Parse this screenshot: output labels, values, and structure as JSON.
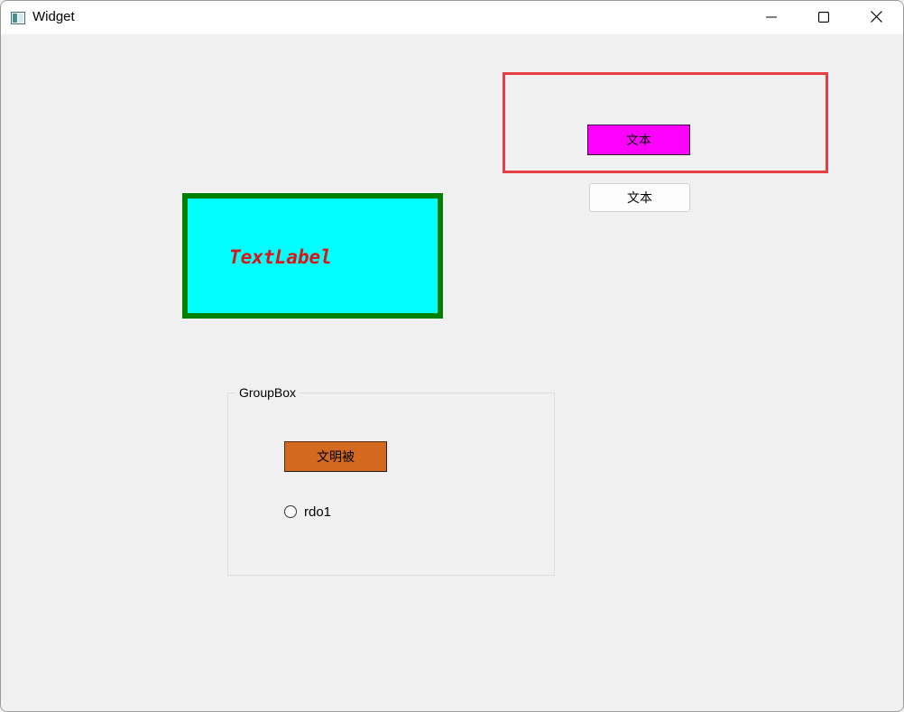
{
  "window": {
    "title": "Widget",
    "icon": "app-window-icon",
    "controls": [
      "minimize-icon",
      "maximize-icon",
      "close-icon"
    ]
  },
  "top_frame": {
    "border_color": "#e84040",
    "button_label": "文本",
    "button_color": "#ff00ff"
  },
  "plain_button": {
    "label": "文本"
  },
  "text_label": {
    "text": "TextLabel",
    "background": "#00ffff",
    "border_color": "#008000",
    "text_color": "#dc1414"
  },
  "groupbox": {
    "title": "GroupBox",
    "button_label": "文明被",
    "button_color": "#d2691e",
    "radio_label": "rdo1",
    "radio_checked": false
  }
}
